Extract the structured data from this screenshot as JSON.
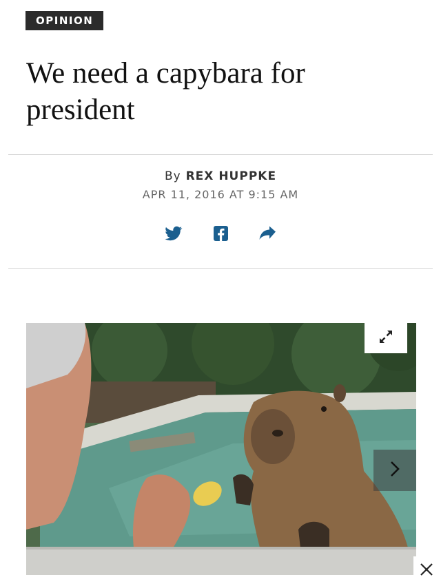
{
  "article": {
    "section": "OPINION",
    "headline": "We need a capybara for president",
    "byline_prefix": "By",
    "author": "REX HUPPKE",
    "date": "APR 11, 2016 AT 9:15 AM"
  },
  "share": {
    "icons": [
      "twitter-icon",
      "facebook-icon",
      "share-arrow-icon"
    ],
    "icon_color": "#1b5f8f"
  },
  "gallery": {
    "controls": [
      "expand-icon",
      "chevron-right-icon"
    ]
  },
  "overlay": {
    "close": "close-icon"
  },
  "colors": {
    "tag_background": "#2b2b2b",
    "share_blue": "#1b5f8f"
  }
}
